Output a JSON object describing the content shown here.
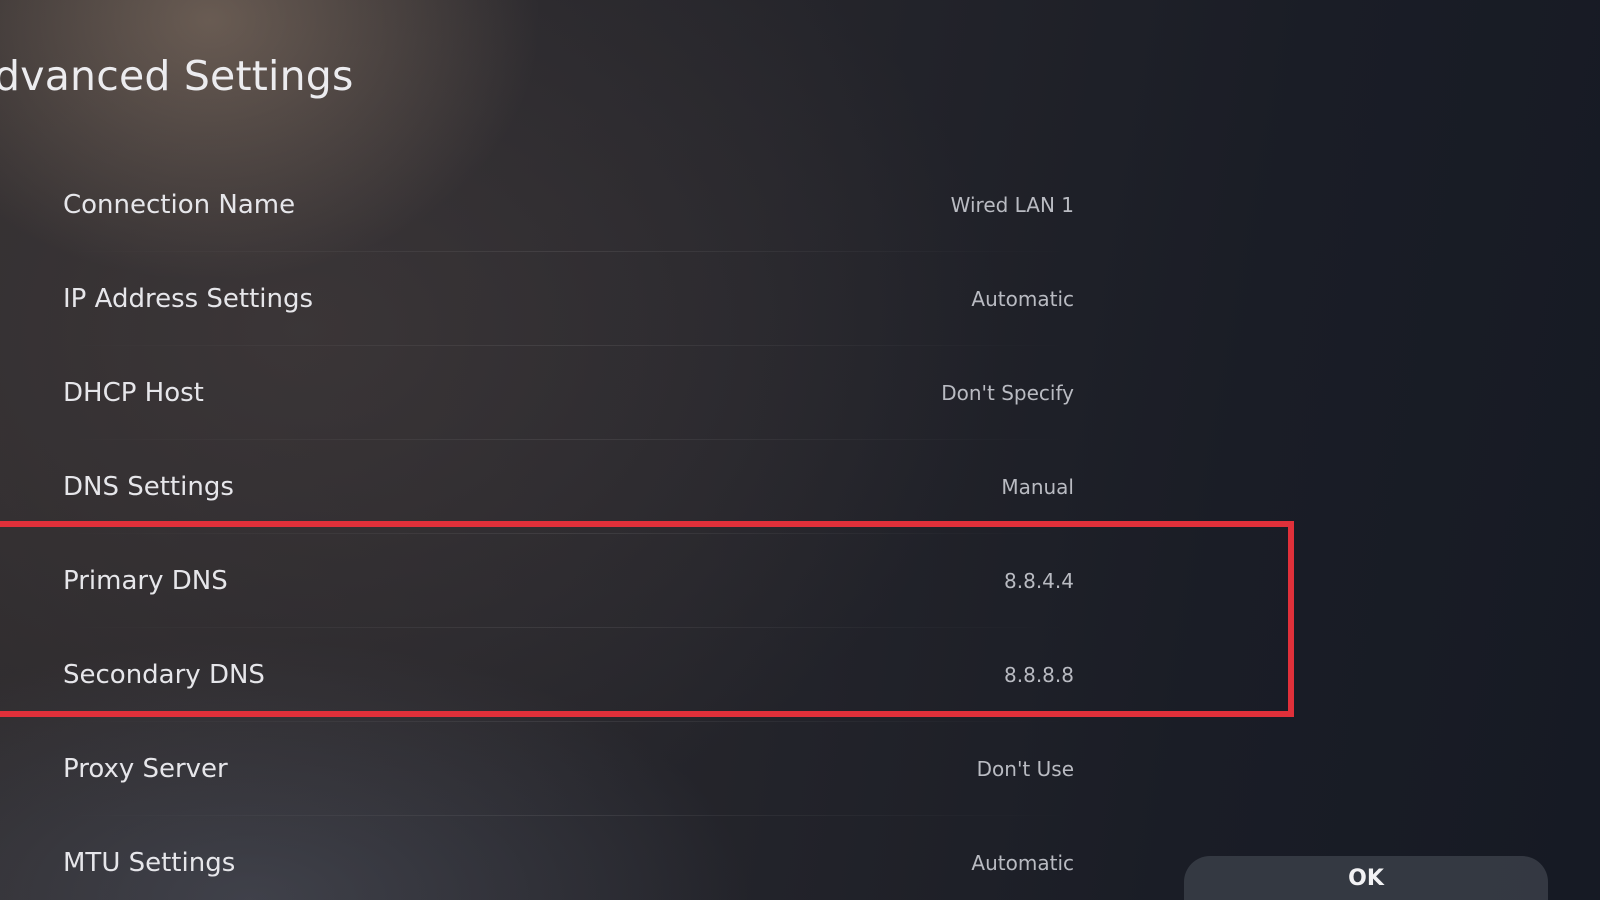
{
  "header": {
    "title": "dvanced Settings"
  },
  "settings": [
    {
      "label": "Connection Name",
      "value": "Wired LAN 1"
    },
    {
      "label": "IP Address Settings",
      "value": "Automatic"
    },
    {
      "label": "DHCP Host",
      "value": "Don't Specify"
    },
    {
      "label": "DNS Settings",
      "value": "Manual"
    },
    {
      "label": "Primary DNS",
      "value": "8.8.4.4"
    },
    {
      "label": "Secondary DNS",
      "value": "8.8.8.8"
    },
    {
      "label": "Proxy Server",
      "value": "Don't Use"
    },
    {
      "label": "MTU Settings",
      "value": "Automatic"
    }
  ],
  "footer": {
    "ok_label": "OK"
  },
  "colors": {
    "highlight": "#e0303a",
    "background": "#1b1e26"
  }
}
